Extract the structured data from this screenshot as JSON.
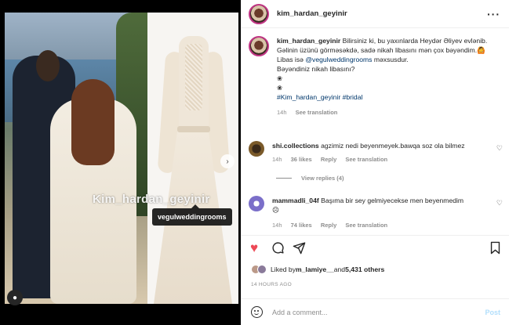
{
  "media": {
    "watermark": "Kim_hardan_geyinir",
    "tag_label": "vegulweddingrooms"
  },
  "header": {
    "username": "kim_hardan_geyinir"
  },
  "caption": {
    "username": "kim_hardan_geyinir",
    "line1": "Bilirsiniz ki, bu yaxınlarda Heydər Əliyev evlənib. Gəlinin üzünü görməsəkdə, sadə nikah libasını mən çox bəyəndim.🙆",
    "line2_prefix": "Libas isə ",
    "line2_link": "@vegulweddingrooms",
    "line2_suffix": " məxsusdur.",
    "line3": "Bəyəndiniz nikah libasını?",
    "emoji1": "❀",
    "emoji2": "❀",
    "hashtags": "#Kim_hardan_geyinir #bridal",
    "time": "14h",
    "see_translation": "See translation"
  },
  "comments": [
    {
      "username": "shi.collections",
      "text": "agzimiz nedi beyenmeyek.bawqa soz ola bilmez",
      "time": "14h",
      "likes": "36 likes",
      "reply": "Reply",
      "see_translation": "See translation"
    },
    {
      "username": "mammadli_04f",
      "text": "Başıma bir sey gelmiyecekse men beyenmedim",
      "emoji": "☹",
      "time": "14h",
      "likes": "74 likes",
      "reply": "Reply",
      "see_translation": "See translation"
    }
  ],
  "view_replies": "View replies (4)",
  "likes": {
    "prefix": "Liked by ",
    "user": "m_lamiye__",
    "middle": " and ",
    "count": "5,431 others"
  },
  "time_ago": "14 HOURS AGO",
  "add_comment": {
    "placeholder": "Add a comment...",
    "post_label": "Post"
  },
  "icons": {
    "heart": "heart-icon",
    "comment": "comment-icon",
    "share": "share-icon",
    "save": "bookmark-icon",
    "more": "more-icon"
  },
  "colors": {
    "like_red": "#ed4956",
    "link_blue": "#00376b",
    "post_disabled": "#b2dffc"
  }
}
